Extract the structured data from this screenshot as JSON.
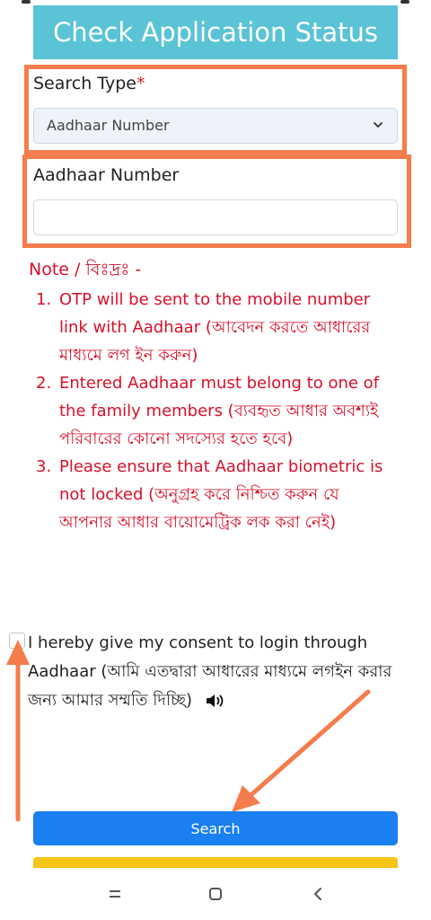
{
  "form": {
    "title": "Check Application Status",
    "search_type_label": "Search Type",
    "required_marker": "*",
    "search_type_value": "Aadhaar Number",
    "aadhaar_label": "Aadhaar Number",
    "aadhaar_value": ""
  },
  "note": {
    "heading": "Note / বিঃদ্রঃ -",
    "items": [
      {
        "num": "1.",
        "text": "OTP will be sent to the mobile number link with Aadhaar (আবেদন করতে আধারের মাধ্যমে লগ ইন করুন)"
      },
      {
        "num": "2.",
        "text": "Entered Aadhaar must belong to one of the family members (ব্যবহৃত আধার অবশ্যই পরিবারের কোনো সদস্যের হতে হবে)"
      },
      {
        "num": "3.",
        "text": "Please ensure that Aadhaar biometric is not locked (অনুগ্রহ করে নিশ্চিত করুন যে আপনার আধার বায়োমেট্রিক লক করা নেই)"
      }
    ]
  },
  "consent": {
    "text": "I hereby give my consent to login through Aadhaar (আমি এতদ্বারা আধারের মাধ্যমে লগইন করার জন্য আমার সম্মতি দিচ্ছি)",
    "checked": false
  },
  "actions": {
    "search_label": "Search"
  },
  "colors": {
    "title_bg": "#5bc3d6",
    "highlight": "#f57c4c",
    "note_text": "#d8102a",
    "search_bg": "#1a7ff0",
    "strip": "#f5c518"
  },
  "icons": {
    "dropdown": "chevron-down-icon",
    "audio": "speaker-icon",
    "nav_recent": "menu-lines-icon",
    "nav_home": "home-square-icon",
    "nav_back": "back-chevron-icon"
  }
}
